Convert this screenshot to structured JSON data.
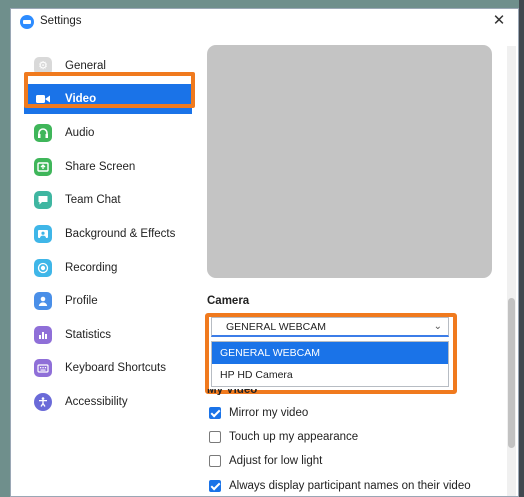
{
  "window": {
    "title": "Settings",
    "close_symbol": "✕"
  },
  "sidebar": {
    "items": [
      {
        "label": "General",
        "icon": "gear-icon",
        "color": "#d9d9d9",
        "active": false
      },
      {
        "label": "Video",
        "icon": "video-camera-icon",
        "color": "#1a73e8",
        "active": true
      },
      {
        "label": "Audio",
        "icon": "headphones-icon",
        "color": "#3fb65a",
        "active": false
      },
      {
        "label": "Share Screen",
        "icon": "share-screen-icon",
        "color": "#3fb65a",
        "active": false
      },
      {
        "label": "Team Chat",
        "icon": "chat-icon",
        "color": "#3fb6a1",
        "active": false
      },
      {
        "label": "Background & Effects",
        "icon": "background-icon",
        "color": "#3fb6e8",
        "active": false
      },
      {
        "label": "Recording",
        "icon": "recording-icon",
        "color": "#3fb6e8",
        "active": false
      },
      {
        "label": "Profile",
        "icon": "profile-icon",
        "color": "#4a8fe8",
        "active": false
      },
      {
        "label": "Statistics",
        "icon": "statistics-icon",
        "color": "#8f6fd8",
        "active": false
      },
      {
        "label": "Keyboard Shortcuts",
        "icon": "keyboard-icon",
        "color": "#8f6fd8",
        "active": false
      },
      {
        "label": "Accessibility",
        "icon": "accessibility-icon",
        "color": "#6a6ad8",
        "active": false
      }
    ]
  },
  "main": {
    "camera_label": "Camera",
    "camera_select": {
      "value": "GENERAL WEBCAM"
    },
    "camera_options": [
      "GENERAL WEBCAM",
      "HP HD Camera"
    ],
    "my_video_label": "My Video",
    "checkboxes": [
      {
        "label": "Mirror my video",
        "checked": true
      },
      {
        "label": "Touch up my appearance",
        "checked": false
      },
      {
        "label": "Adjust for low light",
        "checked": false
      },
      {
        "label": "Always display participant names on their video",
        "checked": true
      }
    ]
  },
  "colors": {
    "accent": "#1a73e8",
    "highlight": "#f07a1e"
  }
}
